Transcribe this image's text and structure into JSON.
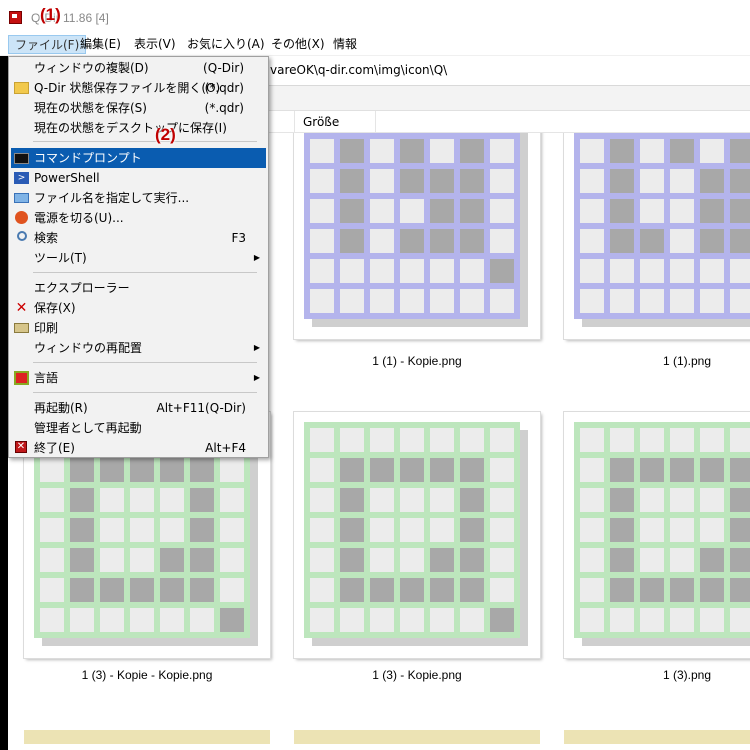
{
  "window": {
    "title": "Q-Dir 11.86 [4]",
    "callout_1": "(1)",
    "callout_2": "(2)"
  },
  "menubar": [
    "ファイル(F)",
    "編集(E)",
    "表示(V)",
    "お気に入り(A)",
    "その他(X)",
    "情報"
  ],
  "address": "vareOK\\q-dir.com\\img\\icon\\Q\\",
  "columns": {
    "size": "Größe"
  },
  "file_menu": [
    {
      "label": "ウィンドウの複製(D)",
      "shortcut": "(Q-Dir)",
      "icon": ""
    },
    {
      "label": "Q-Dir 状態保存ファイルを開く(O)",
      "shortcut": "(*.qdr)",
      "icon": "folder-icon"
    },
    {
      "label": "現在の状態を保存(S)",
      "shortcut": "(*.qdr)",
      "icon": ""
    },
    {
      "label": "現在の状態をデスクトップに保存(I)",
      "shortcut": "",
      "icon": ""
    },
    {
      "label": "コマンドプロンプト",
      "shortcut": "",
      "icon": "cmd-icon",
      "highlighted": true
    },
    {
      "label": "PowerShell",
      "shortcut": "",
      "icon": "powershell-icon"
    },
    {
      "label": "ファイル名を指定して実行...",
      "shortcut": "",
      "icon": "run-icon"
    },
    {
      "label": "電源を切る(U)...",
      "shortcut": "",
      "icon": "power-icon"
    },
    {
      "label": "検索",
      "shortcut": "F3",
      "icon": "search-icon"
    },
    {
      "label": "ツール(T)",
      "shortcut": "",
      "icon": "",
      "submenu": true
    },
    {
      "label": "エクスプローラー",
      "shortcut": "",
      "icon": ""
    },
    {
      "label": "保存(X)",
      "shortcut": "",
      "icon": "save-icon"
    },
    {
      "label": "印刷",
      "shortcut": "",
      "icon": "print-icon"
    },
    {
      "label": "ウィンドウの再配置",
      "shortcut": "",
      "icon": "",
      "submenu": true
    },
    {
      "label": "言語",
      "shortcut": "",
      "icon": "language-icon",
      "submenu": true
    },
    {
      "label": "再起動(R)",
      "shortcut": "Alt+F11(Q-Dir)",
      "icon": ""
    },
    {
      "label": "管理者として再起動",
      "shortcut": "",
      "icon": ""
    },
    {
      "label": "終了(E)",
      "shortcut": "Alt+F4",
      "icon": "exit-icon"
    }
  ],
  "files": [
    {
      "name": "1 (1) - Kopie.png",
      "color": "#b4b4ec"
    },
    {
      "name": "1 (1).png",
      "color": "#b4b4ec"
    },
    {
      "name": "1 (3) - Kopie - Kopie.png",
      "color": "#bde6bd"
    },
    {
      "name": "1 (3) - Kopie.png",
      "color": "#bde6bd"
    },
    {
      "name": "1 (3).png",
      "color": "#bde6bd"
    }
  ]
}
